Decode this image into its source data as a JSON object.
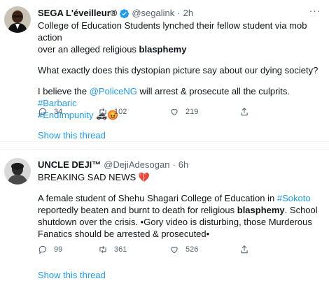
{
  "tweets": [
    {
      "name": "SEGA L'éveilleur®",
      "handle": "@segalink",
      "dot": "·",
      "time": "2h",
      "line1": "College of Education Students lynched their fellow student via mob action",
      "line2a": "over an alleged religious ",
      "line2b": "blasphemy",
      "para2": "What exactly does this dystopian picture say about our dying society?",
      "para3a": "I believe the ",
      "mention": "@PoliceNG",
      "para3b": " will arrest & prosecute all the culprits. ",
      "hashtag1": "#Barbaric",
      "hashtag2": "#EndImpunity",
      "emoji": "🚓😡",
      "replies": "34",
      "retweets": "102",
      "likes": "219",
      "show_thread": "Show this thread",
      "more": "···"
    },
    {
      "name": "UNCLE DEJI™",
      "handle": "@DejiAdesogan",
      "dot": "·",
      "time": "6h",
      "line1a": "BREAKING SAD NEWS ",
      "line1_emoji": "💔",
      "para2a": "A female student of Shehu Shagari College of Education in ",
      "hashtag": "#Sokoto",
      "para2b": "reportedly beaten and burnt to death for religious ",
      "para2c": "blasphemy",
      "para2d": ". School",
      "para2e": "shutdown over the crisis. •Gory video is disturbing, those Murderous",
      "para2f": "Fanatics should be arrested & prosecuted•",
      "replies": "99",
      "retweets": "361",
      "likes": "526",
      "show_thread": "Show this thread"
    }
  ],
  "colors": {
    "link": "#1d9bf0",
    "muted": "#536471",
    "text": "#0f1419"
  }
}
